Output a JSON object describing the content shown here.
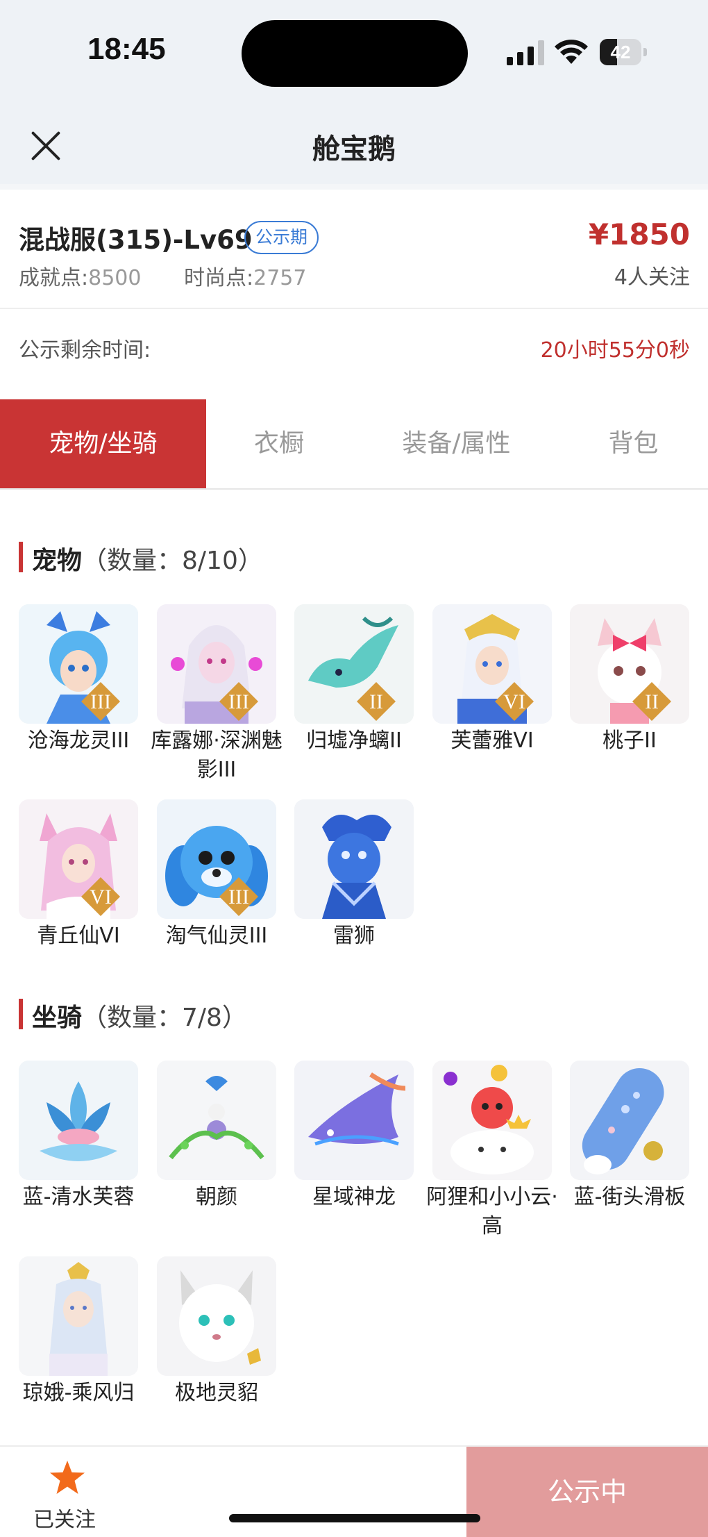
{
  "status": {
    "time": "18:45",
    "battery": "42",
    "battery_level": 0.42
  },
  "nav": {
    "title": "舱宝鹅"
  },
  "listing": {
    "server": "混战服(315)-Lv69",
    "tag": "公示期",
    "price": "¥1850",
    "followers": "4人关注",
    "achievement_label": "成就点:",
    "achievement_value": "8500",
    "fashion_label": "时尚点:",
    "fashion_value": "2757"
  },
  "countdown": {
    "label": "公示剩余时间:",
    "value": "20小时55分0秒"
  },
  "tabs": [
    {
      "label": "宠物/坐骑",
      "active": true
    },
    {
      "label": "衣橱",
      "active": false
    },
    {
      "label": "装备/属性",
      "active": false
    },
    {
      "label": "背包",
      "active": false
    }
  ],
  "pets": {
    "title": "宠物",
    "count": "（数量：8/10）",
    "items": [
      {
        "name": "沧海龙灵III",
        "grade": "III"
      },
      {
        "name": "库露娜·深渊魅影III",
        "grade": "III"
      },
      {
        "name": "归墟净螭II",
        "grade": "II"
      },
      {
        "name": "芙蕾雅VI",
        "grade": "VI"
      },
      {
        "name": "桃子II",
        "grade": "II"
      },
      {
        "name": "青丘仙VI",
        "grade": "VI"
      },
      {
        "name": "淘气仙灵III",
        "grade": "III"
      },
      {
        "name": "雷狮",
        "grade": ""
      }
    ]
  },
  "mounts": {
    "title": "坐骑",
    "count": "（数量：7/8）",
    "items": [
      {
        "name": "蓝-清水芙蓉"
      },
      {
        "name": "朝颜"
      },
      {
        "name": "星域神龙"
      },
      {
        "name": "阿狸和小小云·高"
      },
      {
        "name": "蓝-街头滑板"
      },
      {
        "name": "琼娥-乘风归"
      },
      {
        "name": "极地灵貂"
      }
    ]
  },
  "bottom": {
    "follow_label": "已关注",
    "action_label": "公示中"
  },
  "colors": {
    "accent": "#c93434",
    "price": "#c0302e",
    "tag": "#3a7bd5",
    "action_bg": "#e29c9c",
    "header_bg": "#eef2f6"
  }
}
